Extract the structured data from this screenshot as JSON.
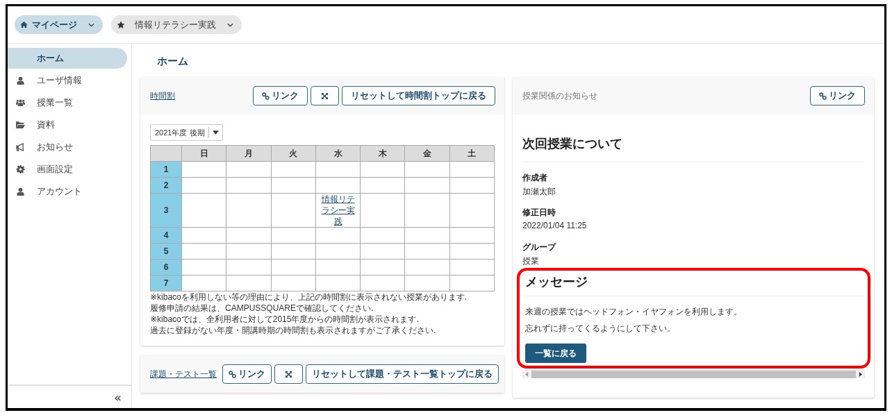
{
  "top_bar": {
    "pills": [
      {
        "label": "マイページ",
        "selected": true
      },
      {
        "label": "情報リテラシー実践",
        "selected": false
      }
    ]
  },
  "sidebar": {
    "items": [
      {
        "label": "ホーム",
        "selected": true
      },
      {
        "label": "ユーザ情報",
        "selected": false
      },
      {
        "label": "授業一覧",
        "selected": false
      },
      {
        "label": "資料",
        "selected": false
      },
      {
        "label": "お知らせ",
        "selected": false
      },
      {
        "label": "画面設定",
        "selected": false
      },
      {
        "label": "アカウント",
        "selected": false
      }
    ],
    "collapse": "«"
  },
  "page_title": "ホーム",
  "timetable_card": {
    "title": "時間割",
    "buttons": [
      {
        "kind": "link",
        "label": "リンク"
      },
      {
        "kind": "expand"
      },
      {
        "kind": "text",
        "label": "リセットして時間割トップに戻る"
      }
    ],
    "term_select": "2021年度 後期",
    "days": [
      "日",
      "月",
      "火",
      "水",
      "木",
      "金",
      "土"
    ],
    "rows": [
      {
        "period": "1",
        "cells": [
          {},
          {},
          {},
          {},
          {},
          {},
          {}
        ]
      },
      {
        "period": "2",
        "cells": [
          {},
          {},
          {},
          {},
          {},
          {},
          {}
        ]
      },
      {
        "period": "3",
        "cells": [
          {},
          {},
          {},
          {
            "course": "情報リテラシー実践"
          },
          {},
          {},
          {}
        ]
      },
      {
        "period": "4",
        "cells": [
          {},
          {},
          {},
          {},
          {},
          {},
          {}
        ]
      },
      {
        "period": "5",
        "cells": [
          {},
          {},
          {},
          {},
          {},
          {},
          {}
        ]
      },
      {
        "period": "6",
        "cells": [
          {},
          {},
          {},
          {},
          {},
          {},
          {}
        ]
      },
      {
        "period": "7",
        "cells": [
          {},
          {},
          {},
          {},
          {},
          {},
          {}
        ]
      }
    ],
    "notes": [
      "※kibacoを利用しない等の理由により、上記の時間割に表示されない授業があります.",
      "履修申請の結果は、CAMPUSSQUAREで確認してください.",
      "※kibacoでは、全利用者に対して2015年度からの時間割が表示されます.",
      "過去に登録がない年度・開講時期の時間割も表示されますがご了承ください."
    ]
  },
  "assignments_card": {
    "title": "課題・テスト一覧",
    "buttons": [
      {
        "kind": "link",
        "label": "リンク"
      },
      {
        "kind": "expand"
      },
      {
        "kind": "text",
        "label": "リセットして課題・テスト一覧トップに戻る"
      }
    ]
  },
  "notice_card": {
    "title": "授業関係のお知らせ",
    "buttons": [
      {
        "kind": "link",
        "label": "リンク"
      }
    ],
    "heading": "次回授業について",
    "fields": [
      {
        "label": "作成者",
        "value": "加瀬太郎"
      },
      {
        "label": "修正日時",
        "value": "2022/01/04 11:25"
      },
      {
        "label": "グループ",
        "value": "授業"
      }
    ],
    "message": {
      "highlighted": true,
      "heading": "メッセージ",
      "lines": [
        "来週の授業ではヘッドフォン・イヤフォンを利用します。",
        "忘れずに持ってくるようにして下さい。"
      ],
      "button": "一覧に戻る"
    }
  }
}
